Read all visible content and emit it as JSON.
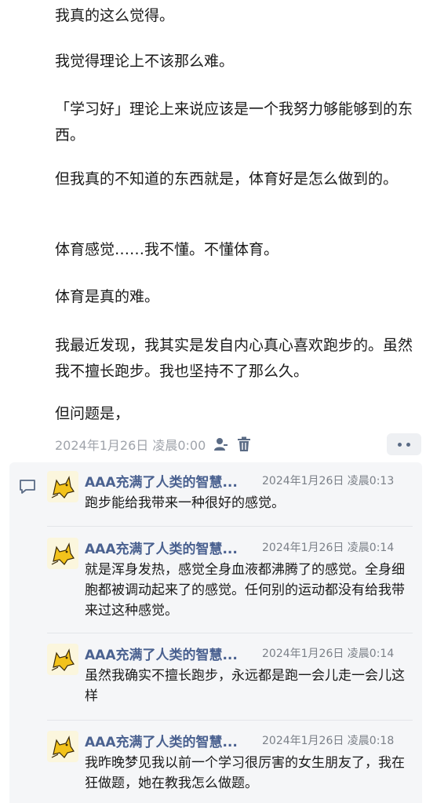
{
  "post": {
    "paragraphs": [
      "我真的这么觉得。",
      "我觉得理论上不该那么难。",
      "「学习好」理论上来说应该是一个我努力够能够到的东西。",
      "但我真的不知道的东西就是，体育好是怎么做到的。",
      "体育感觉……我不懂。不懂体育。",
      "体育是真的难。",
      "我最近发现，我其实是发自内心真心喜欢跑步的。虽然我不擅长跑步。我也坚持不了那么久。",
      "但问题是，"
    ],
    "date": "2024年1月26日 凌晨0:00"
  },
  "comments": [
    {
      "author": "AAA充满了人类的智慧...",
      "time": "2024年1月26日 凌晨0:13",
      "text": "跑步能给我带来一种很好的感觉。"
    },
    {
      "author": "AAA充满了人类的智慧...",
      "time": "2024年1月26日 凌晨0:14",
      "text": "就是浑身发热，感觉全身血液都沸腾了的感觉。全身细胞都被调动起来了的感觉。任何别的运动都没有给我带来过这种感觉。"
    },
    {
      "author": "AAA充满了人类的智慧...",
      "time": "2024年1月26日 凌晨0:14",
      "text": "虽然我确实不擅长跑步，永远都是跑一会儿走一会儿这样"
    },
    {
      "author": "AAA充满了人类的智慧...",
      "time": "2024年1月26日 凌晨0:18",
      "text": "我昨晚梦见我以前一个学习很厉害的女生朋友了，我在狂做题，她在教我怎么做题。"
    }
  ],
  "icons": {
    "author": "person-icon",
    "delete": "trash-icon",
    "more": "more-dots-icon",
    "comment": "comment-icon",
    "avatar": "yellow-cat-avatar"
  },
  "colors": {
    "name": "#4a6190",
    "meta": "#a0a4ab",
    "icon": "#5a6b85",
    "comment_bg": "#f5f6f8",
    "text": "#1a1a1a"
  }
}
